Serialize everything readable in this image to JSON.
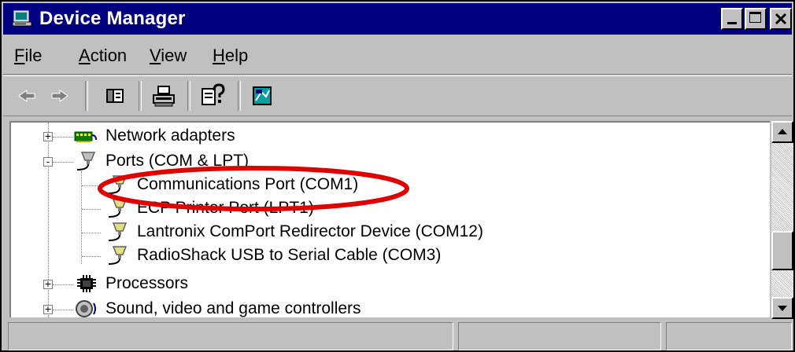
{
  "window": {
    "title": "Device Manager",
    "controls": [
      "minimize",
      "maximize",
      "close"
    ]
  },
  "menu": {
    "items": [
      {
        "label": "File",
        "accel": "F",
        "rest": "ile"
      },
      {
        "label": "Action",
        "accel": "A",
        "rest": "ction"
      },
      {
        "label": "View",
        "accel": "V",
        "rest": "iew"
      },
      {
        "label": "Help",
        "accel": "H",
        "rest": "elp"
      }
    ]
  },
  "toolbar": {
    "buttons": [
      "back-icon",
      "forward-icon",
      "show-hide-tree-icon",
      "print-icon",
      "help-icon",
      "properties-icon"
    ]
  },
  "tree": {
    "items": [
      {
        "label": "Network adapters",
        "icon": "network-adapter-icon",
        "expander": "+"
      },
      {
        "label": "Ports (COM & LPT)",
        "icon": "port-icon",
        "expander": "-"
      },
      {
        "label": "Communications Port (COM1)",
        "icon": "port-icon"
      },
      {
        "label": "ECP Printer Port (LPT1)",
        "icon": "port-icon"
      },
      {
        "label": "Lantronix ComPort Redirector Device (COM12)",
        "icon": "port-icon"
      },
      {
        "label": "RadioShack USB to Serial Cable (COM3)",
        "icon": "port-icon"
      },
      {
        "label": "Processors",
        "icon": "processor-icon",
        "expander": "+"
      },
      {
        "label": "Sound, video and game controllers",
        "icon": "sound-icon",
        "expander": "+"
      }
    ]
  },
  "colors": {
    "titlebar": "#000080",
    "highlight_oval": "#e00000",
    "face": "#c0c0c0"
  }
}
